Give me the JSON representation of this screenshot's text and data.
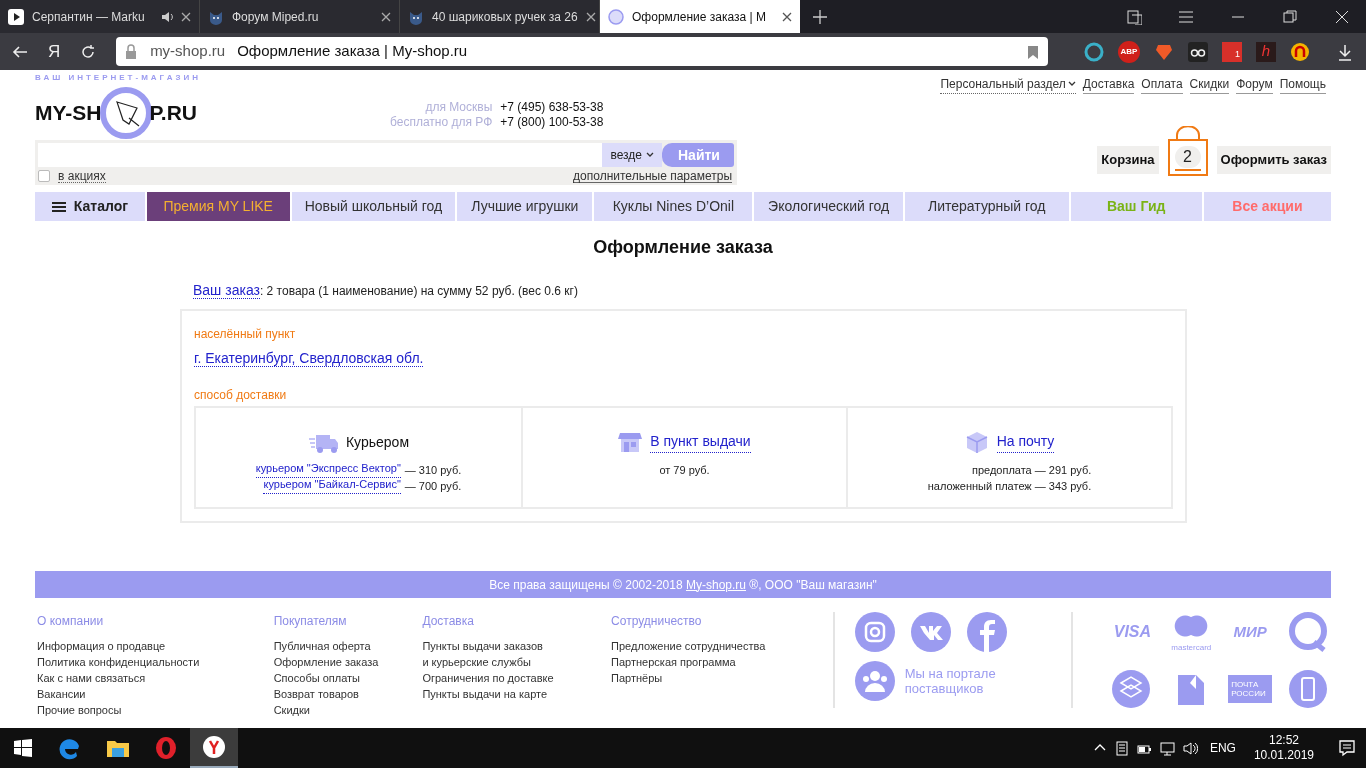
{
  "browser": {
    "tabs": [
      {
        "title": "Серпантин — Marku",
        "selected": false,
        "kind": "play",
        "sound": true
      },
      {
        "title": "Форум Miped.ru",
        "selected": false,
        "kind": "cat",
        "sound": false
      },
      {
        "title": "40 шариковых ручек за 26",
        "selected": false,
        "kind": "cat",
        "sound": false
      },
      {
        "title": "Оформление заказа | M",
        "selected": true,
        "kind": "circle",
        "sound": false
      }
    ],
    "address": {
      "domain": "my-shop.ru",
      "title": "Оформление заказа | My-shop.ru"
    },
    "yandex_button": "Я",
    "extensions": [
      {
        "kind": "alice"
      },
      {
        "kind": "abp",
        "label": "ABP"
      },
      {
        "kind": "brave"
      },
      {
        "kind": "owl"
      },
      {
        "kind": "badge",
        "label": "1"
      },
      {
        "kind": "h",
        "label": "h"
      },
      {
        "kind": "ring"
      }
    ]
  },
  "site": {
    "logo": {
      "tagline": "ВАШ ИНТЕРНЕТ-МАГАЗИН",
      "left": "MY-SH",
      "right": "P.RU"
    },
    "top_links": [
      {
        "label": "Персональный раздел",
        "dropdown": true
      },
      {
        "label": "Доставка",
        "dropdown": false
      },
      {
        "label": "Оплата",
        "dropdown": false
      },
      {
        "label": "Скидки",
        "dropdown": false
      },
      {
        "label": "Форум",
        "dropdown": false
      },
      {
        "label": "Помощь",
        "dropdown": false
      }
    ],
    "phones": [
      {
        "label": "для Москвы",
        "number": "+7 (495) 638-53-38"
      },
      {
        "label": "бесплатно для РФ",
        "number": "+7 (800) 100-53-38"
      }
    ],
    "search": {
      "scope": "везде",
      "button": "Найти",
      "promo_checkbox": {
        "label": "в акциях",
        "checked": false
      },
      "advanced": "дополнительные параметры"
    },
    "cart": {
      "label": "Корзина",
      "count": "2",
      "checkout": "Оформить заказ"
    },
    "nav": [
      {
        "label": "Каталог",
        "kind": "catalog",
        "selected": false
      },
      {
        "label": "Премия MY LIKE",
        "kind": "link",
        "selected": true
      },
      {
        "label": "Новый школьный год",
        "kind": "link",
        "selected": false
      },
      {
        "label": "Лучшие игрушки",
        "kind": "link",
        "selected": false
      },
      {
        "label": "Куклы Nines D’Onil",
        "kind": "link",
        "selected": false
      },
      {
        "label": "Экологический год",
        "kind": "link",
        "selected": false
      },
      {
        "label": "Литературный год",
        "kind": "link",
        "selected": false
      },
      {
        "label": "Ваш Гид",
        "kind": "guide",
        "selected": false
      },
      {
        "label": "Все акции",
        "kind": "sale",
        "selected": false
      }
    ]
  },
  "page": {
    "title": "Оформление заказа",
    "order_link": "Ваш заказ",
    "order_summary": ": 2 товара (1 наименование) на сумму 52 руб. (вес 0.6 кг)",
    "city_label": "населённый пункт",
    "city": "г. Екатеринбург, Свердловская обл.",
    "delivery_label": "способ доставки",
    "delivery_options": [
      {
        "kind": "truck",
        "title": "Курьером",
        "linked": false,
        "lines": [
          {
            "link": "курьером \"Экспресс Вектор\"",
            "text": "— 310 руб."
          },
          {
            "link": "курьером \"Байкал-Сервис\"",
            "text": "— 700 руб."
          }
        ]
      },
      {
        "kind": "store",
        "title": "В пункт выдачи",
        "linked": true,
        "lines": [
          {
            "text": "от 79 руб."
          }
        ]
      },
      {
        "kind": "box",
        "title": "На почту",
        "linked": true,
        "lines": [
          {
            "text": "предоплата — 291 руб."
          },
          {
            "text": "наложенный платеж — 343 руб."
          }
        ]
      }
    ]
  },
  "footer": {
    "copyright": {
      "before": "Все права защищены © 2002-2018 ",
      "link": "My-shop.ru",
      "after": " ®, ООО \"Ваш магазин\""
    },
    "columns": [
      {
        "heading": "О компании",
        "links": [
          "Информация о продавце",
          "Политика конфиденциальности",
          "Как с нами связаться",
          "Вакансии",
          "Прочие вопросы"
        ]
      },
      {
        "heading": "Покупателям",
        "links": [
          "Публичная оферта",
          "Оформление заказа",
          "Способы оплаты",
          "Возврат товаров",
          "Скидки"
        ]
      },
      {
        "heading": "Доставка",
        "links": [
          "Пункты выдачи заказов",
          "и курьерские службы",
          "Ограничения по доставке",
          "Пункты выдачи на карте"
        ]
      },
      {
        "heading": "Сотрудничество",
        "links": [
          "Предложение сотрудничества",
          "Партнерская программа",
          "Партнёры"
        ]
      }
    ],
    "socials": [
      {
        "kind": "instagram"
      },
      {
        "kind": "vk"
      },
      {
        "kind": "facebook"
      }
    ],
    "suppliers": "Мы на портале поставщиков",
    "payments": [
      {
        "kind": "visa",
        "label": "VISA"
      },
      {
        "kind": "mastercard",
        "label": "mastercard"
      },
      {
        "kind": "mir",
        "label": "МИР"
      },
      {
        "kind": "qiwi"
      },
      {
        "kind": "webmoney"
      },
      {
        "kind": "yandex"
      },
      {
        "kind": "post",
        "label": "ПОЧТА РОССИИ"
      },
      {
        "kind": "phone"
      }
    ]
  },
  "taskbar": {
    "apps": [
      {
        "kind": "edge",
        "selected": false
      },
      {
        "kind": "explorer",
        "selected": false
      },
      {
        "kind": "opera",
        "selected": false
      },
      {
        "kind": "yandex",
        "selected": true
      }
    ],
    "language": "ENG",
    "time": "12:52",
    "date": "10.01.2019"
  }
}
